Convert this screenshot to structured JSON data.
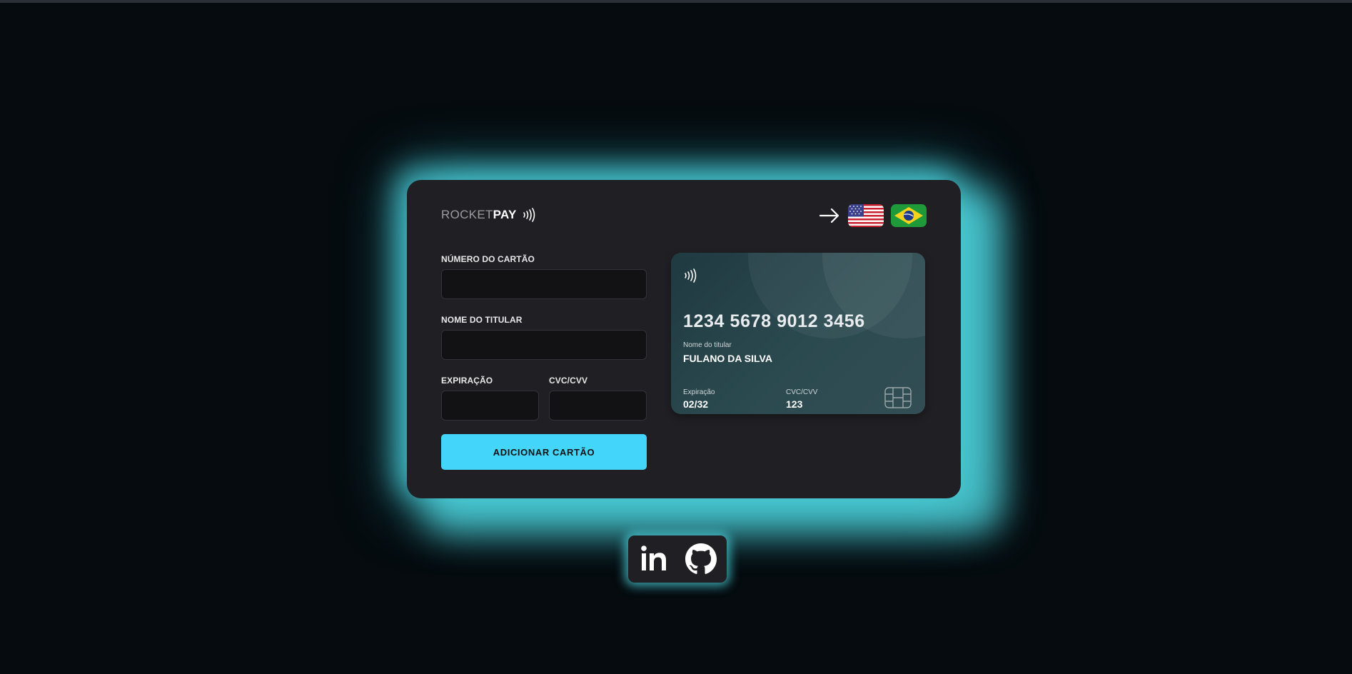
{
  "header": {
    "logo_light": "ROCKET",
    "logo_bold": "PAY",
    "language_arrow_icon": "arrow-right-icon",
    "flags": [
      "flag-us-icon",
      "flag-br-icon"
    ]
  },
  "form": {
    "card_number_label": "NÚMERO DO CARTÃO",
    "card_number_value": "",
    "holder_label": "NOME DO TITULAR",
    "holder_value": "",
    "expiration_label": "EXPIRAÇÃO",
    "expiration_value": "",
    "cvc_label": "CVC/CVV",
    "cvc_value": "",
    "submit_label": "ADICIONAR CARTÃO"
  },
  "card_preview": {
    "number": "1234 5678 9012 3456",
    "holder_caption": "Nome do titular",
    "holder_name": "FULANO DA SILVA",
    "expiration_caption": "Expiração",
    "expiration_value": "02/32",
    "cvc_caption": "CVC/CVV",
    "cvc_value": "123"
  },
  "social": {
    "icons": [
      "linkedin-icon",
      "github-icon"
    ]
  },
  "colors": {
    "background": "#050b0f",
    "panel": "#202024",
    "glow": "#4cd2dc",
    "accent_button": "#43d6fa",
    "card_bg": "#2b4a50"
  }
}
